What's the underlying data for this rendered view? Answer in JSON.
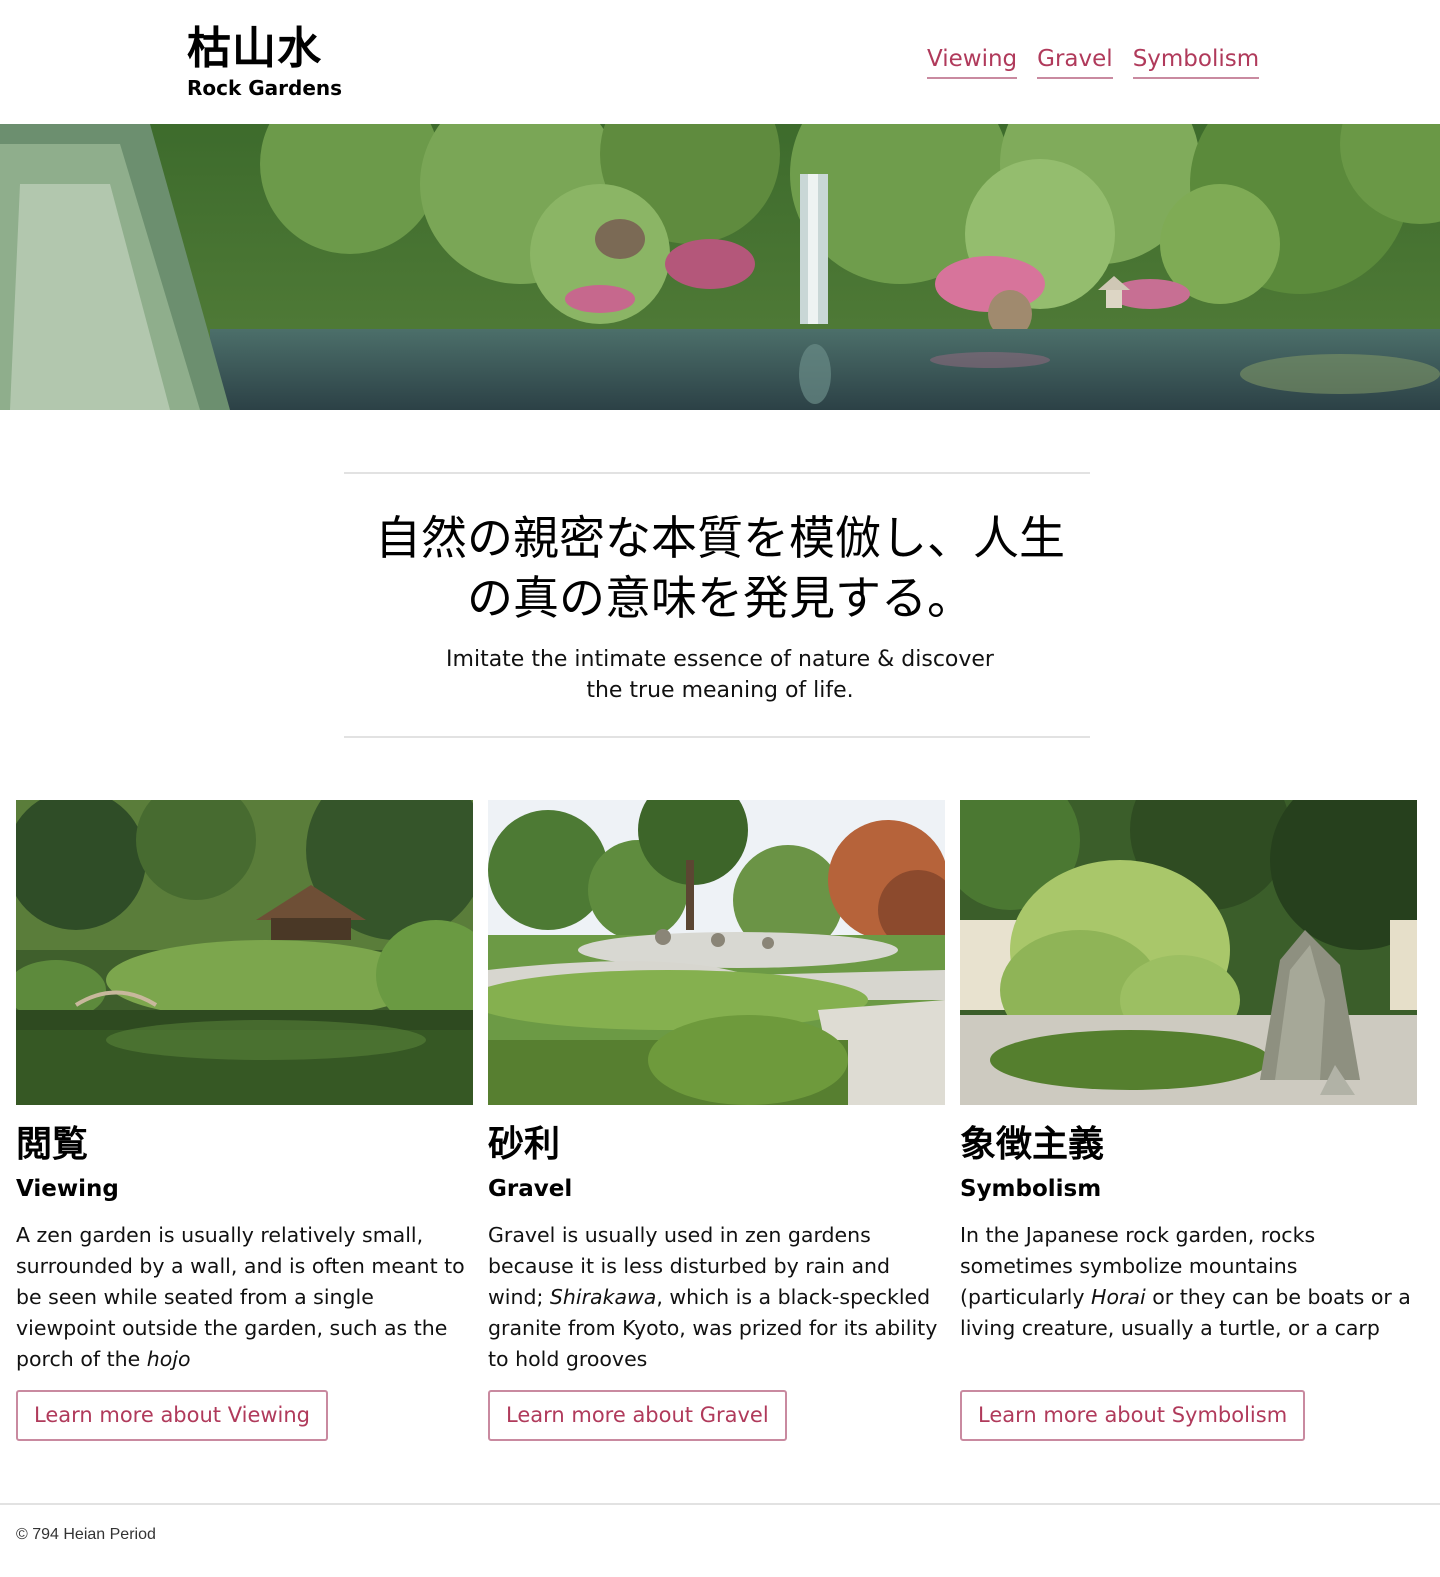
{
  "header": {
    "title_jp": "枯山水",
    "title_en": "Rock Gardens",
    "nav": [
      {
        "label": "Viewing"
      },
      {
        "label": "Gravel"
      },
      {
        "label": "Symbolism"
      }
    ]
  },
  "intro": {
    "jp": "自然の親密な本質を模倣し、人生の真の意味を発見する。",
    "en_line1": "Imitate the intimate essence of nature & discover",
    "en_line2": "the true meaning of life."
  },
  "cards": [
    {
      "heading_jp": "閲覧",
      "heading_en": "Viewing",
      "text_before": "A zen garden is usually relatively small, surrounded by a wall, and is often meant to be seen while seated from a single viewpoint outside the garden, such as the porch of the ",
      "text_italic": "hojo",
      "text_after": "",
      "button": "Learn more about Viewing"
    },
    {
      "heading_jp": "砂利",
      "heading_en": "Gravel",
      "text_before": "Gravel is usually used in zen gardens because it is less disturbed by rain and wind; ",
      "text_italic": "Shirakawa",
      "text_after": ", which is a black-speckled granite from Kyoto, was prized for its ability to hold grooves",
      "button": "Learn more about Gravel"
    },
    {
      "heading_jp": "象徴主義",
      "heading_en": "Symbolism",
      "text_before": "In the Japanese rock garden, rocks sometimes symbolize mountains (particularly ",
      "text_italic": "Horai",
      "text_after": " or they can be boats or a living creature, usually a turtle, or a carp",
      "button": "Learn more about Symbolism"
    }
  ],
  "footer": {
    "text": "© 794 Heian Period"
  },
  "colors": {
    "accent": "#b03a5b",
    "accent_border": "#c98aa0",
    "rule": "#e2e2e2"
  }
}
